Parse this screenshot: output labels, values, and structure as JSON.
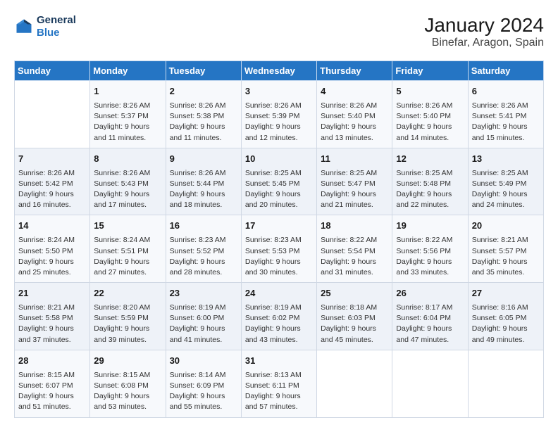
{
  "logo": {
    "line1": "General",
    "line2": "Blue"
  },
  "title": "January 2024",
  "subtitle": "Binefar, Aragon, Spain",
  "weekdays": [
    "Sunday",
    "Monday",
    "Tuesday",
    "Wednesday",
    "Thursday",
    "Friday",
    "Saturday"
  ],
  "weeks": [
    [
      {
        "day": "",
        "info": ""
      },
      {
        "day": "1",
        "sunrise": "8:26 AM",
        "sunset": "5:37 PM",
        "daylight": "9 hours and 11 minutes."
      },
      {
        "day": "2",
        "sunrise": "8:26 AM",
        "sunset": "5:38 PM",
        "daylight": "9 hours and 11 minutes."
      },
      {
        "day": "3",
        "sunrise": "8:26 AM",
        "sunset": "5:39 PM",
        "daylight": "9 hours and 12 minutes."
      },
      {
        "day": "4",
        "sunrise": "8:26 AM",
        "sunset": "5:40 PM",
        "daylight": "9 hours and 13 minutes."
      },
      {
        "day": "5",
        "sunrise": "8:26 AM",
        "sunset": "5:40 PM",
        "daylight": "9 hours and 14 minutes."
      },
      {
        "day": "6",
        "sunrise": "8:26 AM",
        "sunset": "5:41 PM",
        "daylight": "9 hours and 15 minutes."
      }
    ],
    [
      {
        "day": "7",
        "sunrise": "8:26 AM",
        "sunset": "5:42 PM",
        "daylight": "9 hours and 16 minutes."
      },
      {
        "day": "8",
        "sunrise": "8:26 AM",
        "sunset": "5:43 PM",
        "daylight": "9 hours and 17 minutes."
      },
      {
        "day": "9",
        "sunrise": "8:26 AM",
        "sunset": "5:44 PM",
        "daylight": "9 hours and 18 minutes."
      },
      {
        "day": "10",
        "sunrise": "8:25 AM",
        "sunset": "5:45 PM",
        "daylight": "9 hours and 20 minutes."
      },
      {
        "day": "11",
        "sunrise": "8:25 AM",
        "sunset": "5:47 PM",
        "daylight": "9 hours and 21 minutes."
      },
      {
        "day": "12",
        "sunrise": "8:25 AM",
        "sunset": "5:48 PM",
        "daylight": "9 hours and 22 minutes."
      },
      {
        "day": "13",
        "sunrise": "8:25 AM",
        "sunset": "5:49 PM",
        "daylight": "9 hours and 24 minutes."
      }
    ],
    [
      {
        "day": "14",
        "sunrise": "8:24 AM",
        "sunset": "5:50 PM",
        "daylight": "9 hours and 25 minutes."
      },
      {
        "day": "15",
        "sunrise": "8:24 AM",
        "sunset": "5:51 PM",
        "daylight": "9 hours and 27 minutes."
      },
      {
        "day": "16",
        "sunrise": "8:23 AM",
        "sunset": "5:52 PM",
        "daylight": "9 hours and 28 minutes."
      },
      {
        "day": "17",
        "sunrise": "8:23 AM",
        "sunset": "5:53 PM",
        "daylight": "9 hours and 30 minutes."
      },
      {
        "day": "18",
        "sunrise": "8:22 AM",
        "sunset": "5:54 PM",
        "daylight": "9 hours and 31 minutes."
      },
      {
        "day": "19",
        "sunrise": "8:22 AM",
        "sunset": "5:56 PM",
        "daylight": "9 hours and 33 minutes."
      },
      {
        "day": "20",
        "sunrise": "8:21 AM",
        "sunset": "5:57 PM",
        "daylight": "9 hours and 35 minutes."
      }
    ],
    [
      {
        "day": "21",
        "sunrise": "8:21 AM",
        "sunset": "5:58 PM",
        "daylight": "9 hours and 37 minutes."
      },
      {
        "day": "22",
        "sunrise": "8:20 AM",
        "sunset": "5:59 PM",
        "daylight": "9 hours and 39 minutes."
      },
      {
        "day": "23",
        "sunrise": "8:19 AM",
        "sunset": "6:00 PM",
        "daylight": "9 hours and 41 minutes."
      },
      {
        "day": "24",
        "sunrise": "8:19 AM",
        "sunset": "6:02 PM",
        "daylight": "9 hours and 43 minutes."
      },
      {
        "day": "25",
        "sunrise": "8:18 AM",
        "sunset": "6:03 PM",
        "daylight": "9 hours and 45 minutes."
      },
      {
        "day": "26",
        "sunrise": "8:17 AM",
        "sunset": "6:04 PM",
        "daylight": "9 hours and 47 minutes."
      },
      {
        "day": "27",
        "sunrise": "8:16 AM",
        "sunset": "6:05 PM",
        "daylight": "9 hours and 49 minutes."
      }
    ],
    [
      {
        "day": "28",
        "sunrise": "8:15 AM",
        "sunset": "6:07 PM",
        "daylight": "9 hours and 51 minutes."
      },
      {
        "day": "29",
        "sunrise": "8:15 AM",
        "sunset": "6:08 PM",
        "daylight": "9 hours and 53 minutes."
      },
      {
        "day": "30",
        "sunrise": "8:14 AM",
        "sunset": "6:09 PM",
        "daylight": "9 hours and 55 minutes."
      },
      {
        "day": "31",
        "sunrise": "8:13 AM",
        "sunset": "6:11 PM",
        "daylight": "9 hours and 57 minutes."
      },
      {
        "day": "",
        "info": ""
      },
      {
        "day": "",
        "info": ""
      },
      {
        "day": "",
        "info": ""
      }
    ]
  ]
}
